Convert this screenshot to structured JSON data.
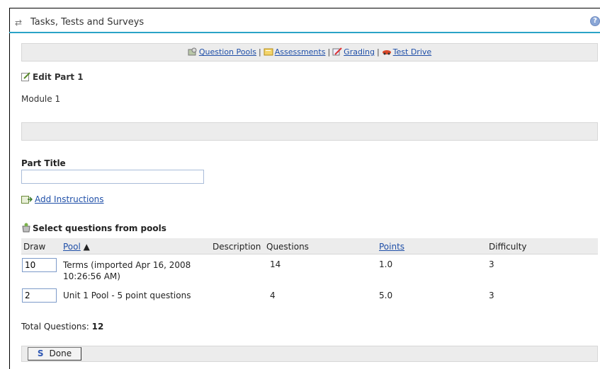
{
  "header": {
    "title": "Tasks, Tests and Surveys"
  },
  "nav": {
    "items": [
      {
        "label": "Question Pools",
        "icon": "question-pools-icon"
      },
      {
        "label": "Assessments",
        "icon": "assessments-icon"
      },
      {
        "label": "Grading",
        "icon": "grading-icon"
      },
      {
        "label": "Test Drive",
        "icon": "test-drive-icon"
      }
    ],
    "separator": "|"
  },
  "edit": {
    "heading": "Edit Part 1",
    "module": "Module 1"
  },
  "part_title": {
    "label": "Part Title",
    "value": ""
  },
  "instructions": {
    "link": "Add Instructions"
  },
  "pools": {
    "heading": "Select questions from pools",
    "columns": {
      "draw": "Draw",
      "pool": "Pool",
      "sort": "▲",
      "description": "Description",
      "questions": "Questions",
      "points": "Points",
      "difficulty": "Difficulty"
    },
    "rows": [
      {
        "draw": "10",
        "pool_line1": "Terms (imported Apr 16, 2008",
        "pool_line2": "10:26:56 AM)",
        "questions": "14",
        "points": "1.0",
        "difficulty": "3"
      },
      {
        "draw": "2",
        "pool_line1": "Unit 1 Pool - 5 point questions",
        "pool_line2": "",
        "questions": "4",
        "points": "5.0",
        "difficulty": "3"
      }
    ]
  },
  "total": {
    "label": "Total Questions:",
    "value": "12"
  },
  "footer": {
    "done_label": "Done"
  },
  "colors": {
    "accent_line": "#2aa3c7",
    "link": "#1f4fa8",
    "bar_bg": "#ececec"
  }
}
